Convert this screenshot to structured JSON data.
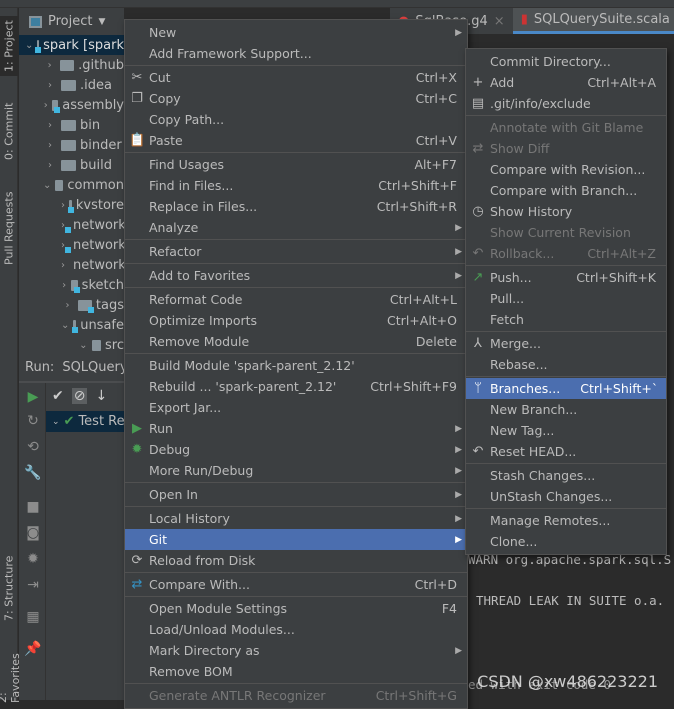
{
  "left_tabs": {
    "project": "1: Project",
    "commit": "0: Commit",
    "pull_requests": "Pull Requests",
    "structure": "7: Structure",
    "favorites": "2: Favorites"
  },
  "project_panel": {
    "title": "Project",
    "tree": [
      {
        "label": "spark [spark",
        "expanded": true,
        "indent": 0,
        "module": true,
        "selected": true
      },
      {
        "label": ".github",
        "expanded": false,
        "indent": 1,
        "module": false
      },
      {
        "label": ".idea",
        "expanded": false,
        "indent": 1,
        "module": false
      },
      {
        "label": "assembly",
        "expanded": false,
        "indent": 1,
        "module": true
      },
      {
        "label": "bin",
        "expanded": false,
        "indent": 1,
        "module": false
      },
      {
        "label": "binder",
        "expanded": false,
        "indent": 1,
        "module": false
      },
      {
        "label": "build",
        "expanded": false,
        "indent": 1,
        "module": false
      },
      {
        "label": "common",
        "expanded": true,
        "indent": 1,
        "module": false
      },
      {
        "label": "kvstore",
        "expanded": false,
        "indent": 2,
        "module": true
      },
      {
        "label": "network",
        "expanded": false,
        "indent": 2,
        "module": true
      },
      {
        "label": "network",
        "expanded": false,
        "indent": 2,
        "module": true
      },
      {
        "label": "network",
        "expanded": false,
        "indent": 2,
        "module": false
      },
      {
        "label": "sketch",
        "expanded": false,
        "indent": 2,
        "module": true
      },
      {
        "label": "tags",
        "expanded": false,
        "indent": 2,
        "module": true
      },
      {
        "label": "unsafe",
        "expanded": true,
        "indent": 2,
        "module": true
      },
      {
        "label": "src",
        "expanded": true,
        "indent": 3,
        "module": false
      }
    ]
  },
  "run_panel": {
    "label": "Run:",
    "config": "SQLQuerySuite",
    "test_row": "Test Results"
  },
  "editor_tabs": [
    {
      "label": "SqlBase.g4"
    },
    {
      "label": "SQLQuerySuite.scala",
      "active": true
    }
  ],
  "console": {
    "line1": "WARN org.apache.spark.sql.S",
    "line2": "THREAD LEAK IN SUITE o.a.",
    "line3": "ed with exit code 0"
  },
  "context_menu": [
    {
      "label": "New",
      "arrow": true
    },
    {
      "label": "Add Framework Support..."
    },
    {
      "sep": true
    },
    {
      "label": "Cut",
      "shortcut": "Ctrl+X",
      "icon": "scissors-icon",
      "glyph": "✂"
    },
    {
      "label": "Copy",
      "shortcut": "Ctrl+C",
      "icon": "copy-icon",
      "glyph": "❐"
    },
    {
      "label": "Copy Path..."
    },
    {
      "label": "Paste",
      "shortcut": "Ctrl+V",
      "icon": "clipboard-icon",
      "glyph": "📋"
    },
    {
      "sep": true
    },
    {
      "label": "Find Usages",
      "shortcut": "Alt+F7"
    },
    {
      "label": "Find in Files...",
      "shortcut": "Ctrl+Shift+F"
    },
    {
      "label": "Replace in Files...",
      "shortcut": "Ctrl+Shift+R"
    },
    {
      "label": "Analyze",
      "arrow": true
    },
    {
      "sep": true
    },
    {
      "label": "Refactor",
      "arrow": true
    },
    {
      "sep": true
    },
    {
      "label": "Add to Favorites",
      "arrow": true
    },
    {
      "sep": true
    },
    {
      "label": "Reformat Code",
      "shortcut": "Ctrl+Alt+L"
    },
    {
      "label": "Optimize Imports",
      "shortcut": "Ctrl+Alt+O"
    },
    {
      "label": "Remove Module",
      "shortcut": "Delete"
    },
    {
      "sep": true
    },
    {
      "label": "Build Module 'spark-parent_2.12'"
    },
    {
      "label": "Rebuild ... 'spark-parent_2.12'",
      "shortcut": "Ctrl+Shift+F9"
    },
    {
      "label": "Export Jar..."
    },
    {
      "label": "Run",
      "arrow": true,
      "icon": "run-icon",
      "glyph": "▶",
      "color": "#499c54"
    },
    {
      "label": "Debug",
      "arrow": true,
      "icon": "debug-icon",
      "glyph": "✹",
      "color": "#499c54"
    },
    {
      "label": "More Run/Debug",
      "arrow": true
    },
    {
      "sep": true
    },
    {
      "label": "Open In",
      "arrow": true
    },
    {
      "sep": true
    },
    {
      "label": "Local History",
      "arrow": true
    },
    {
      "label": "Git",
      "arrow": true,
      "highlighted": true
    },
    {
      "label": "Reload from Disk",
      "icon": "reload-icon",
      "glyph": "⟳"
    },
    {
      "sep": true
    },
    {
      "label": "Compare With...",
      "shortcut": "Ctrl+D",
      "icon": "compare-icon",
      "glyph": "⇄",
      "color": "#3592c4"
    },
    {
      "sep": true
    },
    {
      "label": "Open Module Settings",
      "shortcut": "F4"
    },
    {
      "label": "Load/Unload Modules..."
    },
    {
      "label": "Mark Directory as",
      "arrow": true
    },
    {
      "label": "Remove BOM"
    },
    {
      "sep": true
    },
    {
      "label": "Generate ANTLR Recognizer",
      "shortcut": "Ctrl+Shift+G",
      "disabled": true
    }
  ],
  "git_submenu": [
    {
      "label": "Commit Directory..."
    },
    {
      "label": "Add",
      "shortcut": "Ctrl+Alt+A",
      "icon": "plus-icon",
      "glyph": "+"
    },
    {
      "label": ".git/info/exclude",
      "icon": "ignore-file-icon",
      "glyph": "▤"
    },
    {
      "sep": true
    },
    {
      "label": "Annotate with Git Blame",
      "disabled": true
    },
    {
      "label": "Show Diff",
      "disabled": true,
      "icon": "diff-icon",
      "glyph": "⇄"
    },
    {
      "label": "Compare with Revision..."
    },
    {
      "label": "Compare with Branch..."
    },
    {
      "label": "Show History",
      "icon": "clock-icon",
      "glyph": "◷"
    },
    {
      "label": "Show Current Revision",
      "disabled": true
    },
    {
      "label": "Rollback...",
      "shortcut": "Ctrl+Alt+Z",
      "disabled": true,
      "icon": "rollback-icon",
      "glyph": "↶"
    },
    {
      "sep": true
    },
    {
      "label": "Push...",
      "shortcut": "Ctrl+Shift+K",
      "icon": "push-icon",
      "glyph": "↗",
      "color": "#499c54"
    },
    {
      "label": "Pull..."
    },
    {
      "label": "Fetch"
    },
    {
      "sep": true
    },
    {
      "label": "Merge...",
      "icon": "merge-icon",
      "glyph": "⅄"
    },
    {
      "label": "Rebase..."
    },
    {
      "sep": true
    },
    {
      "label": "Branches...",
      "shortcut": "Ctrl+Shift+`",
      "highlighted": true,
      "icon": "branch-icon",
      "glyph": "ᛘ"
    },
    {
      "label": "New Branch..."
    },
    {
      "label": "New Tag..."
    },
    {
      "label": "Reset HEAD...",
      "icon": "reset-icon",
      "glyph": "↶"
    },
    {
      "sep": true
    },
    {
      "label": "Stash Changes..."
    },
    {
      "label": "UnStash Changes..."
    },
    {
      "sep": true
    },
    {
      "label": "Manage Remotes..."
    },
    {
      "label": "Clone..."
    }
  ],
  "watermark": "CSDN @xw486223221"
}
